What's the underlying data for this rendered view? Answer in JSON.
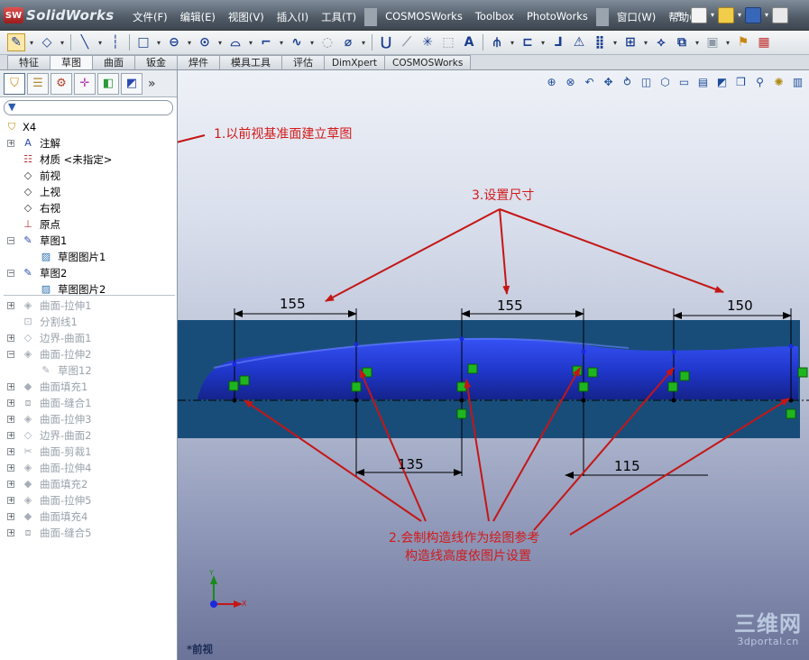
{
  "app": {
    "logo_badge": "SW",
    "logo_text": "SolidWorks"
  },
  "menu": {
    "items": [
      "文件(F)",
      "编辑(E)",
      "视图(V)",
      "插入(I)",
      "工具(T)",
      "COSMOSWorks",
      "Toolbox",
      "PhotoWorks",
      "窗口(W)",
      "帮助(H)"
    ]
  },
  "tabs": {
    "items": [
      {
        "label": "特征",
        "active": false
      },
      {
        "label": "草图",
        "active": true
      },
      {
        "label": "曲面",
        "active": false
      },
      {
        "label": "钣金",
        "active": false
      },
      {
        "label": "焊件",
        "active": false
      },
      {
        "label": "模具工具",
        "active": false
      },
      {
        "label": "评估",
        "active": false
      },
      {
        "label": "DimXpert",
        "active": false
      },
      {
        "label": "COSMOSWorks",
        "active": false
      }
    ]
  },
  "panel": {
    "expand_label": "»"
  },
  "tree": {
    "root": "X4",
    "items": [
      {
        "label": "注解",
        "icon": "annotation-icon",
        "level": 1,
        "expander": "+",
        "dim": false
      },
      {
        "label": "材质 <未指定>",
        "icon": "material-icon",
        "level": 1,
        "expander": "",
        "dim": false
      },
      {
        "label": "前视",
        "icon": "plane-icon",
        "level": 1,
        "expander": "",
        "dim": false
      },
      {
        "label": "上视",
        "icon": "plane-icon",
        "level": 1,
        "expander": "",
        "dim": false
      },
      {
        "label": "右视",
        "icon": "plane-icon",
        "level": 1,
        "expander": "",
        "dim": false
      },
      {
        "label": "原点",
        "icon": "origin-icon",
        "level": 1,
        "expander": "",
        "dim": false
      },
      {
        "label": "草图1",
        "icon": "sketch-icon",
        "level": 1,
        "expander": "−",
        "dim": false
      },
      {
        "label": "草图图片1",
        "icon": "sketch-picture-icon",
        "level": 2,
        "expander": "",
        "dim": false
      },
      {
        "label": "草图2",
        "icon": "sketch-icon",
        "level": 1,
        "expander": "−",
        "dim": false
      },
      {
        "label": "草图图片2",
        "icon": "sketch-picture-icon",
        "level": 2,
        "expander": "",
        "dim": false
      },
      {
        "label": "曲面-拉伸1",
        "icon": "surface-extrude-icon",
        "level": 1,
        "expander": "+",
        "dim": true
      },
      {
        "label": "分割线1",
        "icon": "split-line-icon",
        "level": 1,
        "expander": "",
        "dim": true
      },
      {
        "label": "边界-曲面1",
        "icon": "boundary-surface-icon",
        "level": 1,
        "expander": "+",
        "dim": true
      },
      {
        "label": "曲面-拉伸2",
        "icon": "surface-extrude-icon",
        "level": 1,
        "expander": "−",
        "dim": true
      },
      {
        "label": "草图12",
        "icon": "sketch-icon",
        "level": 2,
        "expander": "",
        "dim": true
      },
      {
        "label": "曲面填充1",
        "icon": "surface-fill-icon",
        "level": 1,
        "expander": "+",
        "dim": true
      },
      {
        "label": "曲面-缝合1",
        "icon": "surface-knit-icon",
        "level": 1,
        "expander": "+",
        "dim": true
      },
      {
        "label": "曲面-拉伸3",
        "icon": "surface-extrude-icon",
        "level": 1,
        "expander": "+",
        "dim": true
      },
      {
        "label": "边界-曲面2",
        "icon": "boundary-surface-icon",
        "level": 1,
        "expander": "+",
        "dim": true
      },
      {
        "label": "曲面-剪裁1",
        "icon": "surface-trim-icon",
        "level": 1,
        "expander": "+",
        "dim": true
      },
      {
        "label": "曲面-拉伸4",
        "icon": "surface-extrude-icon",
        "level": 1,
        "expander": "+",
        "dim": true
      },
      {
        "label": "曲面填充2",
        "icon": "surface-fill-icon",
        "level": 1,
        "expander": "+",
        "dim": true
      },
      {
        "label": "曲面-拉伸5",
        "icon": "surface-extrude-icon",
        "level": 1,
        "expander": "+",
        "dim": true
      },
      {
        "label": "曲面填充4",
        "icon": "surface-fill-icon",
        "level": 1,
        "expander": "+",
        "dim": true
      },
      {
        "label": "曲面-缝合5",
        "icon": "surface-knit-icon",
        "level": 1,
        "expander": "+",
        "dim": true
      }
    ]
  },
  "view": {
    "name": "*前视",
    "callout1": "1.以前视基准面建立草图",
    "callout2_line1": "2.会制构造线作为绘图参考",
    "callout2_line2": "构造线高度依图片设置",
    "callout3": "3.设置尺寸",
    "dimensions": [
      "155",
      "155",
      "150",
      "135",
      "115"
    ],
    "triad_x": "X",
    "triad_y": "Y",
    "watermark_main": "三维网",
    "watermark_sub": "3dportal.cn"
  },
  "colors": {
    "callout": "#d21a1a",
    "plane": "#184d7a",
    "model": "#2b46e8",
    "relation": "#1fb51f"
  }
}
